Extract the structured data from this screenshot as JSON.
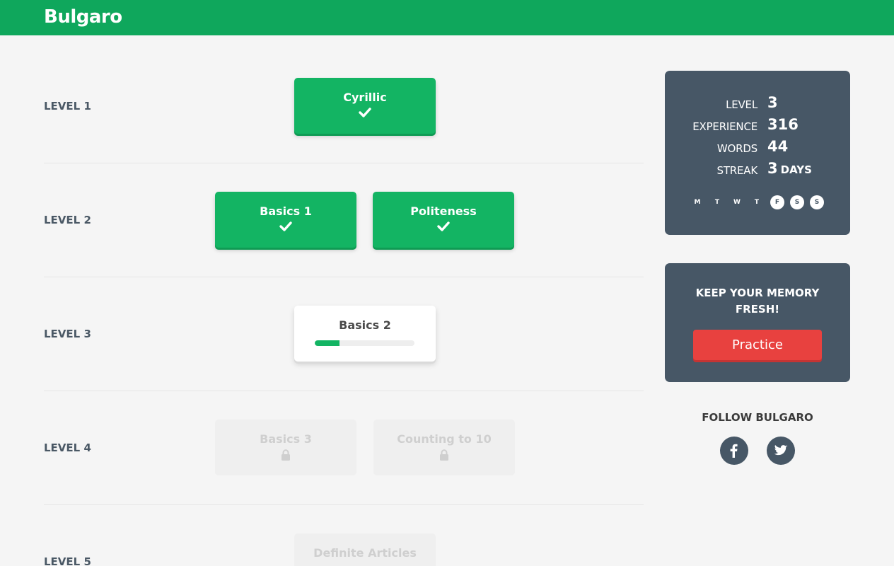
{
  "app": {
    "title": "Bulgaro"
  },
  "colors": {
    "brand": "#0fa75c",
    "done": "#13b463",
    "panel": "#475766",
    "practice": "#e8413f",
    "locked": "#efefef"
  },
  "levels": [
    {
      "label": "LEVEL 1",
      "skills": [
        {
          "name": "Cyrillic",
          "state": "done",
          "icon": "check-icon"
        }
      ]
    },
    {
      "label": "LEVEL 2",
      "skills": [
        {
          "name": "Basics 1",
          "state": "done",
          "icon": "check-icon"
        },
        {
          "name": "Politeness",
          "state": "done",
          "icon": "check-icon"
        }
      ]
    },
    {
      "label": "LEVEL 3",
      "skills": [
        {
          "name": "Basics 2",
          "state": "in-progress",
          "progress": 0.25
        }
      ]
    },
    {
      "label": "LEVEL 4",
      "skills": [
        {
          "name": "Basics 3",
          "state": "locked",
          "icon": "lock-icon"
        },
        {
          "name": "Counting to 10",
          "state": "locked",
          "icon": "lock-icon"
        }
      ]
    },
    {
      "label": "LEVEL 5",
      "skills": [
        {
          "name": "Definite Articles",
          "state": "locked",
          "icon": "lock-icon"
        }
      ]
    }
  ],
  "stats": {
    "level_label": "LEVEL",
    "level_value": "3",
    "experience_label": "EXPERIENCE",
    "experience_value": "316",
    "words_label": "WORDS",
    "words_value": "44",
    "streak_label": "STREAK",
    "streak_value": "3",
    "streak_unit": "DAYS",
    "days": [
      {
        "letter": "M",
        "active": false
      },
      {
        "letter": "T",
        "active": false
      },
      {
        "letter": "W",
        "active": false
      },
      {
        "letter": "T",
        "active": false
      },
      {
        "letter": "F",
        "active": true
      },
      {
        "letter": "S",
        "active": true
      },
      {
        "letter": "S",
        "active": true
      }
    ]
  },
  "memory": {
    "title": "KEEP YOUR MEMORY FRESH!",
    "button": "Practice"
  },
  "follow": {
    "title": "FOLLOW BULGARO",
    "icons": [
      "facebook-icon",
      "twitter-icon"
    ]
  }
}
